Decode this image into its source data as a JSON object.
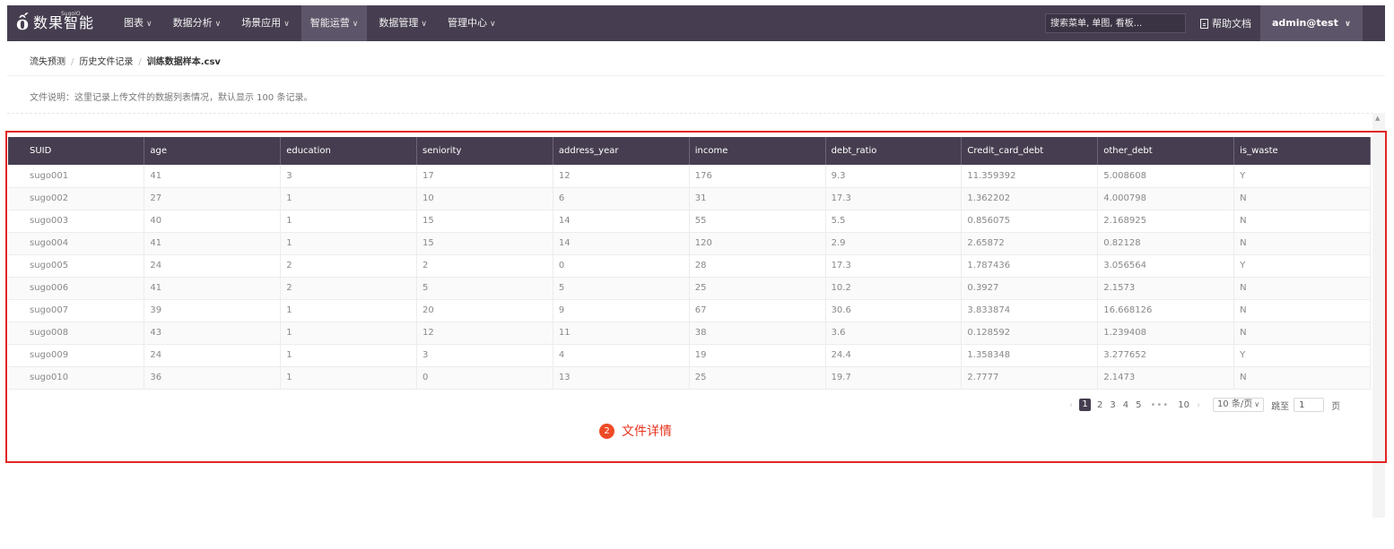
{
  "header": {
    "logo_text": "数果智能",
    "logo_sup": "SugoIO",
    "nav": [
      {
        "label": "图表",
        "active": false
      },
      {
        "label": "数据分析",
        "active": false
      },
      {
        "label": "场景应用",
        "active": false
      },
      {
        "label": "智能运营",
        "active": true
      },
      {
        "label": "数据管理",
        "active": false
      },
      {
        "label": "管理中心",
        "active": false
      }
    ],
    "search_placeholder": "搜索菜单, 单图, 看板...",
    "help_label": "帮助文档",
    "user_label": "admin@test"
  },
  "breadcrumb": [
    "流失预测",
    "历史文件记录",
    "训练数据样本.csv"
  ],
  "description": "文件说明：这里记录上传文件的数据列表情况，默认显示 100 条记录。",
  "table": {
    "columns": [
      "SUID",
      "age",
      "education",
      "seniority",
      "address_year",
      "income",
      "debt_ratio",
      "Credit_card_debt",
      "other_debt",
      "is_waste"
    ],
    "rows": [
      [
        "sugo001",
        "41",
        "3",
        "17",
        "12",
        "176",
        "9.3",
        "11.359392",
        "5.008608",
        "Y"
      ],
      [
        "sugo002",
        "27",
        "1",
        "10",
        "6",
        "31",
        "17.3",
        "1.362202",
        "4.000798",
        "N"
      ],
      [
        "sugo003",
        "40",
        "1",
        "15",
        "14",
        "55",
        "5.5",
        "0.856075",
        "2.168925",
        "N"
      ],
      [
        "sugo004",
        "41",
        "1",
        "15",
        "14",
        "120",
        "2.9",
        "2.65872",
        "0.82128",
        "N"
      ],
      [
        "sugo005",
        "24",
        "2",
        "2",
        "0",
        "28",
        "17.3",
        "1.787436",
        "3.056564",
        "Y"
      ],
      [
        "sugo006",
        "41",
        "2",
        "5",
        "5",
        "25",
        "10.2",
        "0.3927",
        "2.1573",
        "N"
      ],
      [
        "sugo007",
        "39",
        "1",
        "20",
        "9",
        "67",
        "30.6",
        "3.833874",
        "16.668126",
        "N"
      ],
      [
        "sugo008",
        "43",
        "1",
        "12",
        "11",
        "38",
        "3.6",
        "0.128592",
        "1.239408",
        "N"
      ],
      [
        "sugo009",
        "24",
        "1",
        "3",
        "4",
        "19",
        "24.4",
        "1.358348",
        "3.277652",
        "Y"
      ],
      [
        "sugo010",
        "36",
        "1",
        "0",
        "13",
        "25",
        "19.7",
        "2.7777",
        "2.1473",
        "N"
      ]
    ]
  },
  "pagination": {
    "pages": [
      "1",
      "2",
      "3",
      "4",
      "5"
    ],
    "current": "1",
    "dots": "•••",
    "last": "10",
    "page_size": "10 条/页",
    "jump_label": "跳至",
    "jump_value": "1",
    "jump_unit": "页"
  },
  "annotation": {
    "number": "2",
    "text": "文件详情",
    "color": "#e22525"
  }
}
